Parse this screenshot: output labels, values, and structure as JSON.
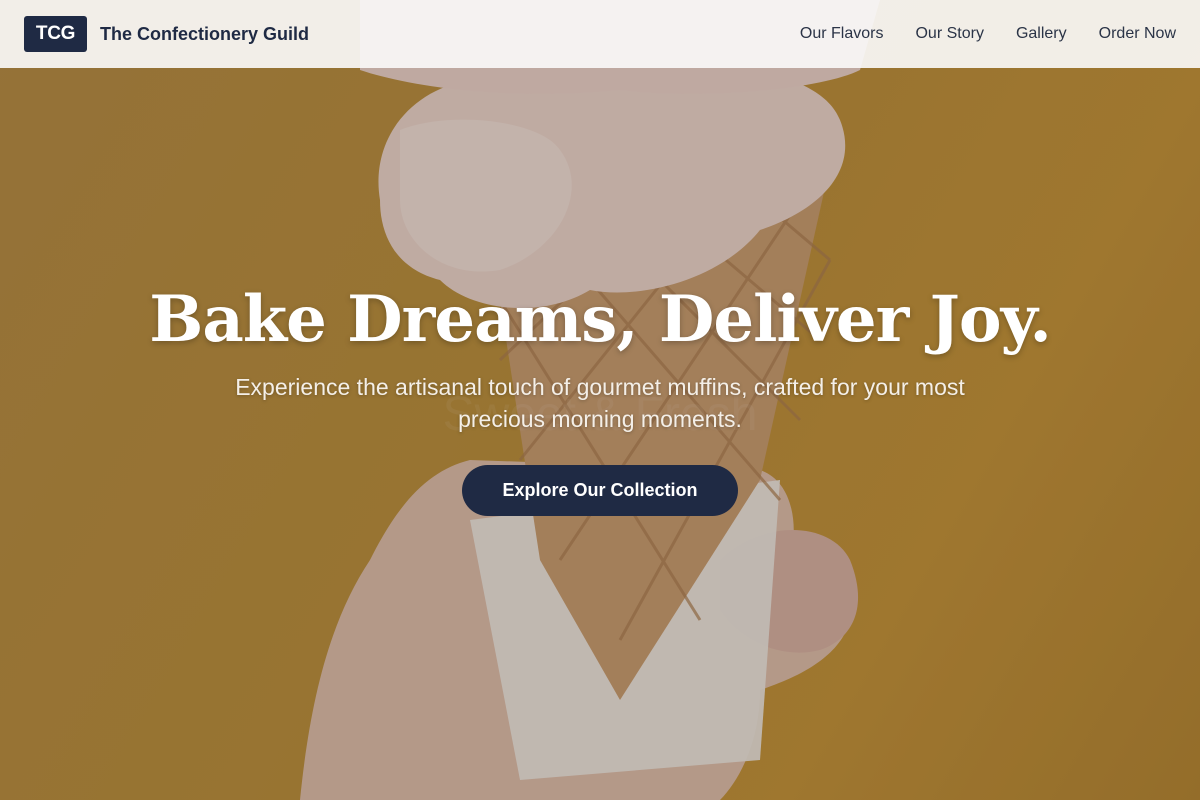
{
  "header": {
    "logo_text": "TCG",
    "brand_name": "The Confectionery Guild",
    "nav": [
      {
        "label": "Our Flavors"
      },
      {
        "label": "Our Story"
      },
      {
        "label": "Gallery"
      },
      {
        "label": "Order Now"
      }
    ]
  },
  "hero": {
    "headline": "Bake Dreams, Deliver Joy.",
    "subheadline": "Experience the artisanal touch of gourmet muffins, crafted for your most precious morning moments.",
    "cta_label": "Explore Our Collection",
    "background_image": "ice-cream-cone-in-hand"
  },
  "colors": {
    "brand_navy": "#1f2a44",
    "hero_background": "#b98c35",
    "navbar_background": "#faf9f7"
  }
}
